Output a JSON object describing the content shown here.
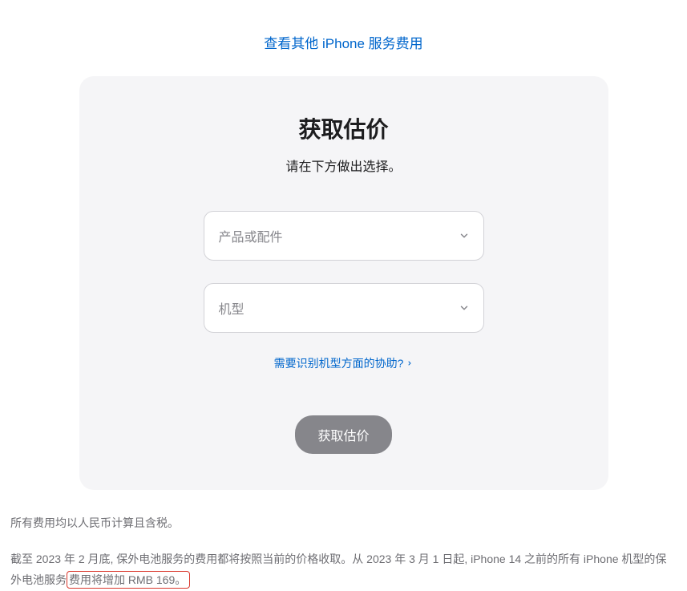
{
  "topLink": {
    "label": "查看其他 iPhone 服务费用"
  },
  "card": {
    "title": "获取估价",
    "subtitle": "请在下方做出选择。",
    "select1": {
      "placeholder": "产品或配件"
    },
    "select2": {
      "placeholder": "机型"
    },
    "helpLink": {
      "label": "需要识别机型方面的协助?"
    },
    "submit": {
      "label": "获取估价"
    }
  },
  "footer": {
    "line1": "所有费用均以人民币计算且含税。",
    "line2_part1": "截至 2023 年 2 月底, 保外电池服务的费用都将按照当前的价格收取。从 2023 年 3 月 1 日起, iPhone 14 之前的所有 iPhone 机型的保外电池服务",
    "line2_highlight": "费用将增加 RMB 169。"
  }
}
